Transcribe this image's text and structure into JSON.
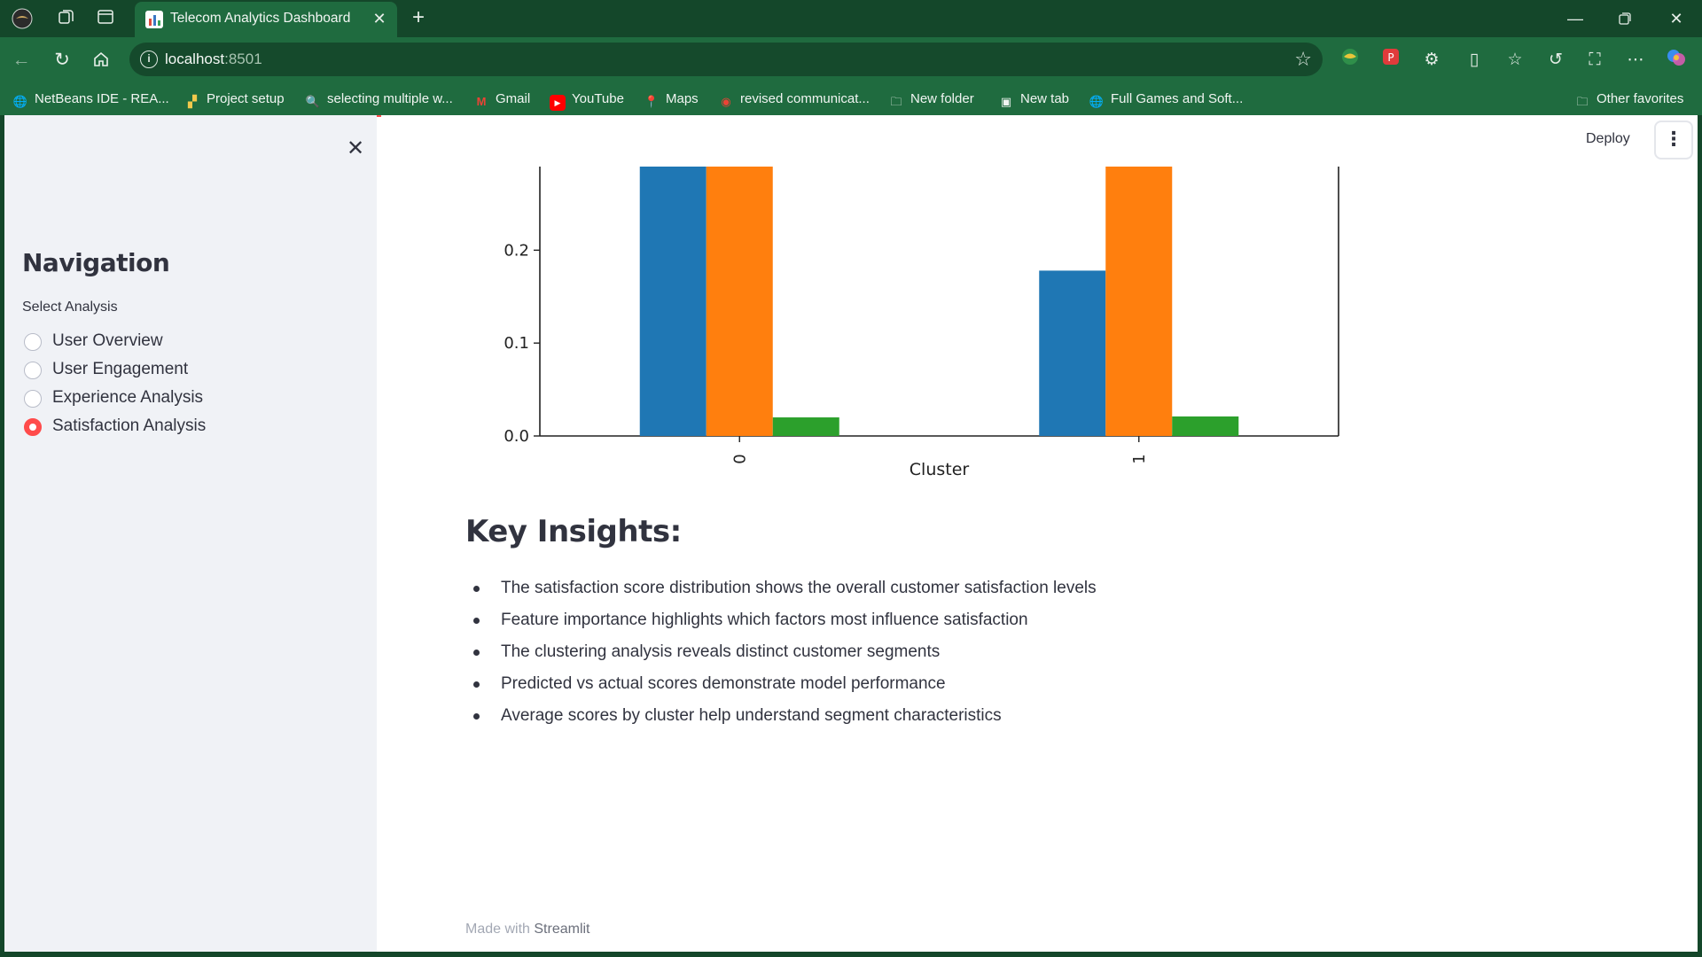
{
  "browser": {
    "tab_title": "Telecom Analytics Dashboard",
    "url_host": "localhost",
    "url_port": ":8501",
    "bookmarks": [
      {
        "label": "NetBeans IDE - REA...",
        "icon": "globe-icon"
      },
      {
        "label": "Project setup",
        "icon": "project-icon"
      },
      {
        "label": "selecting multiple w...",
        "icon": "search-icon"
      },
      {
        "label": "Gmail",
        "icon": "gmail-icon"
      },
      {
        "label": "YouTube",
        "icon": "youtube-icon"
      },
      {
        "label": "Maps",
        "icon": "maps-icon"
      },
      {
        "label": "revised communicat...",
        "icon": "chrome-icon"
      },
      {
        "label": "New folder",
        "icon": "folder-icon"
      },
      {
        "label": "New tab",
        "icon": "newtab-icon"
      },
      {
        "label": "Full Games and Soft...",
        "icon": "globe-icon"
      }
    ],
    "other_favorites": "Other favorites"
  },
  "sidebar": {
    "title": "Navigation",
    "select_label": "Select Analysis",
    "options": [
      {
        "label": "User Overview",
        "selected": false
      },
      {
        "label": "User Engagement",
        "selected": false
      },
      {
        "label": "Experience Analysis",
        "selected": false
      },
      {
        "label": "Satisfaction Analysis",
        "selected": true
      }
    ]
  },
  "header": {
    "deploy_label": "Deploy"
  },
  "chart_data": {
    "type": "bar",
    "categories": [
      "0",
      "1"
    ],
    "series": [
      {
        "color": "#1f77b4",
        "values": [
          0.29,
          0.178
        ]
      },
      {
        "color": "#ff7f0e",
        "values": [
          0.29,
          0.29
        ]
      },
      {
        "color": "#2ca02c",
        "values": [
          0.02,
          0.021
        ]
      }
    ],
    "xlabel": "Cluster",
    "ylim": [
      0,
      0.29
    ],
    "yticks": [
      "0.0",
      "0.1",
      "0.2"
    ],
    "grid": false
  },
  "insights": {
    "title": "Key Insights:",
    "items": [
      "The satisfaction score distribution shows the overall customer satisfaction levels",
      "Feature importance highlights which factors most influence satisfaction",
      "The clustering analysis reveals distinct customer segments",
      "Predicted vs actual scores demonstrate model performance",
      "Average scores by cluster help understand segment characteristics"
    ]
  },
  "footer": {
    "made_with": "Made with",
    "brand": "Streamlit"
  }
}
